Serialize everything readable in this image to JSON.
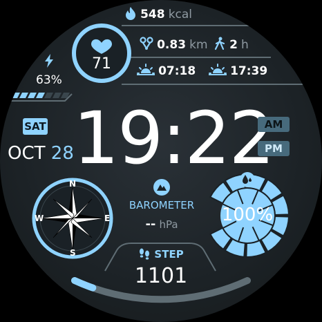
{
  "calories": {
    "value": "548",
    "unit": "kcal"
  },
  "heart_rate": {
    "value": "71"
  },
  "distance": {
    "value": "0.83",
    "unit": "km"
  },
  "active_time": {
    "value": "2",
    "unit": "h"
  },
  "sunrise": {
    "value": "07:18"
  },
  "sunset": {
    "value": "17:39"
  },
  "battery": {
    "percent_label": "63%",
    "level": 0.63
  },
  "clock": {
    "time": "19:22",
    "am_label": "AM",
    "pm_label": "PM",
    "active": "PM"
  },
  "date": {
    "weekday": "SAT",
    "month": "OCT",
    "day": "28"
  },
  "compass": {
    "n": "N",
    "e": "E",
    "s": "S",
    "w": "W"
  },
  "barometer": {
    "label": "BAROMETER",
    "value": "--",
    "unit": "hPa"
  },
  "humidity": {
    "percent_label": "100%",
    "level": 1.0
  },
  "steps": {
    "label": "STEP",
    "value": "1101",
    "progress": 0.11
  },
  "colors": {
    "accent": "#8fd3ff",
    "background": "#1c2226",
    "muted": "#476a7c"
  }
}
